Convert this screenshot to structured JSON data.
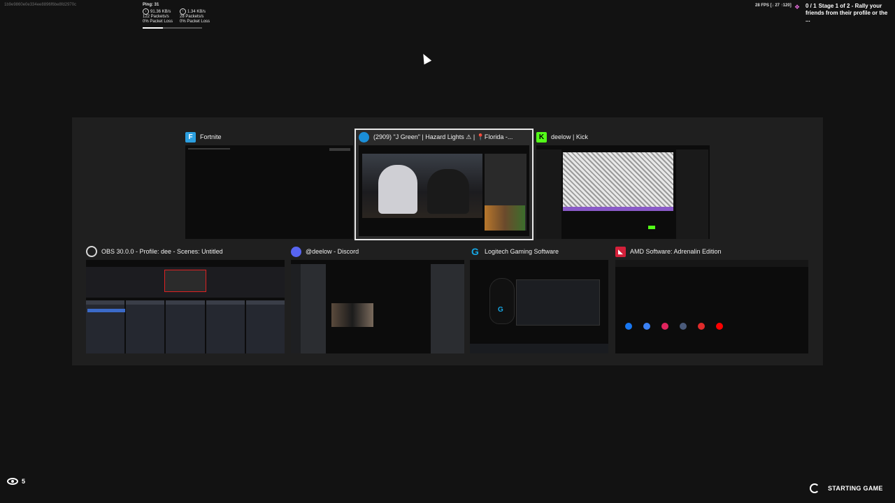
{
  "session_id": "1b9e9860e0e334ee8896f6be8fd2970c",
  "network": {
    "ping": "Ping: 31",
    "down_rate": "91.36 KB/s",
    "down_packets": "122 Packets/s",
    "down_loss": "0% Packet Loss",
    "up_rate": "1.34 KB/s",
    "up_packets": "28 Packets/s",
    "up_loss": "0% Packet Loss",
    "progress": 0.34
  },
  "fps": "28 FPS [↓ 27 ↑120]",
  "quest": {
    "count": "0 / 1",
    "text": "Stage 1 of 2 - Rally your friends from their profile or the ..."
  },
  "switcher": {
    "windows": [
      {
        "title": "Fortnite",
        "icon": "fortnite-icon",
        "icon_text": "F",
        "icon_color": "#2b9fe0"
      },
      {
        "title": "(2909) \"J Green\" | Hazard Lights ⚠ | 📍Florida -...",
        "icon": "edge-browser-icon",
        "icon_color": "#1b8fd8",
        "selected": true
      },
      {
        "title": "deelow | Kick",
        "icon": "kick-icon",
        "icon_text": "K",
        "icon_color": "#53fc18"
      },
      {
        "title": "OBS 30.0.0 - Profile: dee - Scenes: Untitled",
        "icon": "obs-icon",
        "icon_color": "#d8d8d8"
      },
      {
        "title": "@deelow - Discord",
        "icon": "discord-icon",
        "icon_color": "#5865f2"
      },
      {
        "title": "Logitech Gaming Software",
        "icon": "logitech-icon",
        "icon_color": "#16a6e3"
      },
      {
        "title": "AMD Software: Adrenalin Edition",
        "icon": "amd-icon",
        "icon_color": "#d4203a"
      }
    ]
  },
  "spectators": "5",
  "status": "STARTING GAME"
}
